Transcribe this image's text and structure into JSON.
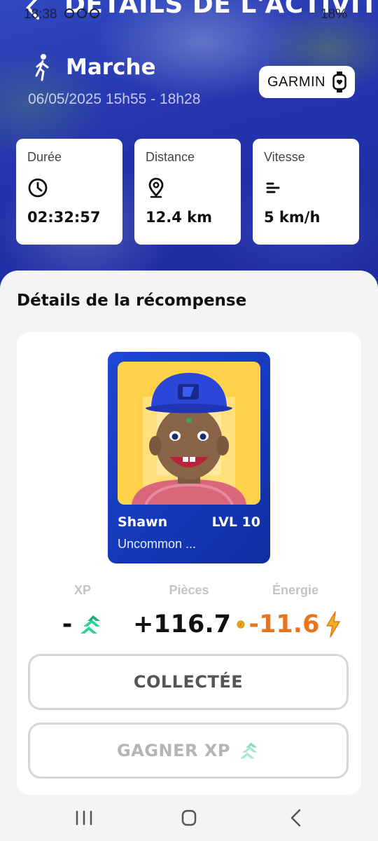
{
  "status_bar": {
    "time": "18:38",
    "battery": "18%"
  },
  "header": {
    "title": "DÉTAILS DE L'ACTIVITÉ"
  },
  "activity": {
    "icon": "walking-person-icon",
    "name": "Marche",
    "date": "06/05/2025 15h55 - 18h28",
    "source": "GARMIN"
  },
  "stats": [
    {
      "label": "Durée",
      "icon": "clock-icon",
      "value": "02:32:57"
    },
    {
      "label": "Distance",
      "icon": "location-pin-icon",
      "value": "12.4 km"
    },
    {
      "label": "Vitesse",
      "icon": "speed-lines-icon",
      "value": "5 km/h"
    }
  ],
  "reward": {
    "title": "Détails de la récompense",
    "nft": {
      "name": "Shawn",
      "level": "LVL 10",
      "rarity": "Uncommon ..."
    },
    "metrics": [
      {
        "label": "XP",
        "value": "-",
        "icon": "xp-chevrons-icon"
      },
      {
        "label": "Pièces",
        "value": "+116.7",
        "icon": "coin-icon"
      },
      {
        "label": "Énergie",
        "value": "-11.6",
        "icon": "lightning-icon"
      }
    ],
    "collected_label": "COLLECTÉE",
    "earn_xp_label": "GAGNER XP"
  },
  "colors": {
    "brand_blue": "#2a3ab6",
    "energy_orange": "#e8741c",
    "xp_green": "#2fd39a",
    "coin_gold": "#f2b21c"
  }
}
